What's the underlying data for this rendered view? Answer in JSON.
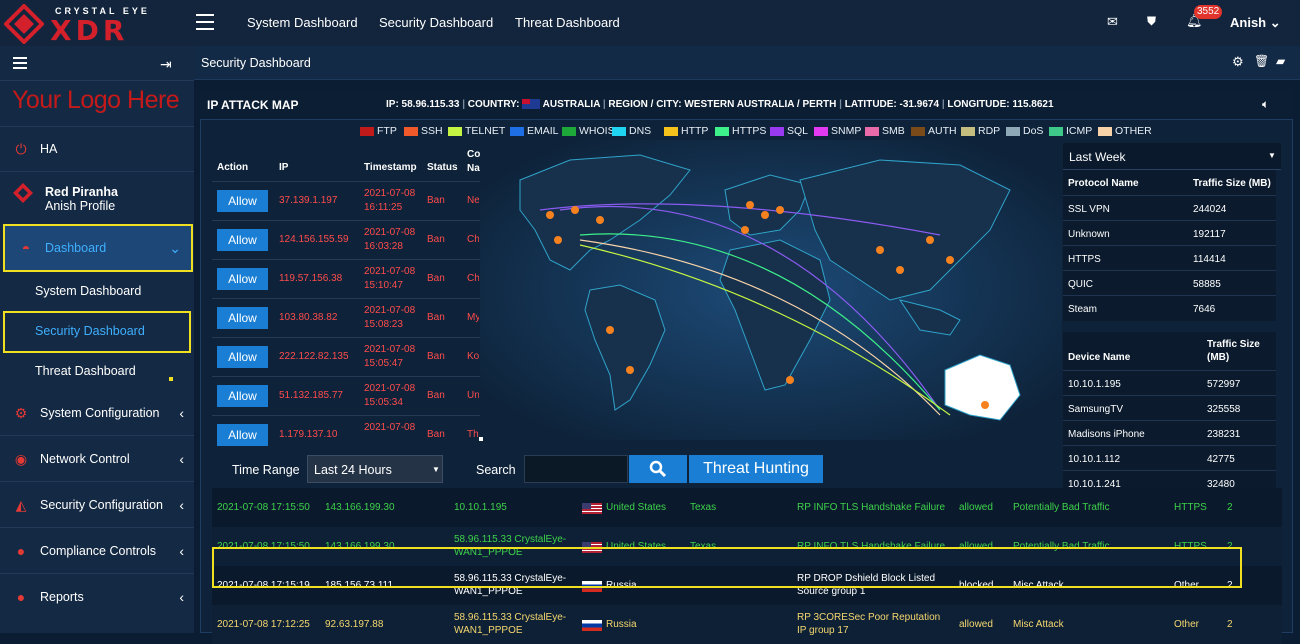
{
  "brand": {
    "title": "CRYSTAL EYE",
    "subtitle": "XDR",
    "logo_here": "Your Logo Here"
  },
  "topnav": {
    "items": [
      "System Dashboard",
      "Security Dashboard",
      "Threat Dashboard"
    ],
    "notif_count": "3552",
    "user": "Anish"
  },
  "sidebar": {
    "ha": "HA",
    "profile_name": "Red Piranha",
    "profile_sub": "Anish Profile",
    "dashboard": "Dashboard",
    "sub_items": [
      "System Dashboard",
      "Security Dashboard",
      "Threat Dashboard"
    ],
    "items": [
      "System Configuration",
      "Network Control",
      "Security Configuration",
      "Compliance Controls",
      "Reports"
    ]
  },
  "content": {
    "title": "Security Dashboard"
  },
  "map_panel": {
    "title": "IP ATTACK MAP",
    "ip": "IP: 58.96.115.33",
    "country_label": "COUNTRY:",
    "country": "AUSTRALIA",
    "region": "REGION / CITY: WESTERN AUSTRALIA / PERTH",
    "latitude": "LATITUDE: -31.9674",
    "longitude": "LONGITUDE: 115.8621"
  },
  "legend": [
    {
      "name": "FTP",
      "color": "#c01a1a"
    },
    {
      "name": "SSH",
      "color": "#f05a2a"
    },
    {
      "name": "TELNET",
      "color": "#c5f542"
    },
    {
      "name": "EMAIL",
      "color": "#1e6fe6"
    },
    {
      "name": "WHOIS",
      "color": "#1fa83a"
    },
    {
      "name": "DNS",
      "color": "#1ed4f0"
    },
    {
      "name": "HTTP",
      "color": "#f5c21c"
    },
    {
      "name": "HTTPS",
      "color": "#3df08a"
    },
    {
      "name": "SQL",
      "color": "#9a3af0"
    },
    {
      "name": "SNMP",
      "color": "#e23af0"
    },
    {
      "name": "SMB",
      "color": "#e86aa8"
    },
    {
      "name": "AUTH",
      "color": "#7a4a18"
    },
    {
      "name": "RDP",
      "color": "#c4bd80"
    },
    {
      "name": "DoS",
      "color": "#8fa8b8"
    },
    {
      "name": "ICMP",
      "color": "#3ec98a"
    },
    {
      "name": "OTHER",
      "color": "#f7d2a8"
    }
  ],
  "attack_table": {
    "headers": [
      "Action",
      "IP",
      "Timestamp",
      "Status",
      "Co\nNa"
    ],
    "action_label": "Allow",
    "rows": [
      {
        "ip": "37.139.1.197",
        "ts1": "2021-07-08",
        "ts2": "16:11:25",
        "status": "Ban",
        "co": "Ne"
      },
      {
        "ip": "124.156.155.59",
        "ts1": "2021-07-08",
        "ts2": "16:03:28",
        "status": "Ban",
        "co": "Ch"
      },
      {
        "ip": "119.57.156.38",
        "ts1": "2021-07-08",
        "ts2": "15:10:47",
        "status": "Ban",
        "co": "Ch"
      },
      {
        "ip": "103.80.38.82",
        "ts1": "2021-07-08",
        "ts2": "15:08:23",
        "status": "Ban",
        "co": "My"
      },
      {
        "ip": "222.122.82.135",
        "ts1": "2021-07-08",
        "ts2": "15:05:47",
        "status": "Ban",
        "co": "Ko Re"
      },
      {
        "ip": "51.132.185.77",
        "ts1": "2021-07-08",
        "ts2": "15:05:34",
        "status": "Ban",
        "co": "Un Kin"
      },
      {
        "ip": "1.179.137.10",
        "ts1": "2021-07-08",
        "ts2": "",
        "status": "Ban",
        "co": "Th"
      }
    ]
  },
  "protocol_table": {
    "range": "Last Week",
    "headers": [
      "Protocol Name",
      "Traffic Size (MB)"
    ],
    "rows": [
      [
        "SSL VPN",
        "244024"
      ],
      [
        "Unknown",
        "192117"
      ],
      [
        "HTTPS",
        "114414"
      ],
      [
        "QUIC",
        "58885"
      ],
      [
        "Steam",
        "7646"
      ]
    ]
  },
  "device_table": {
    "headers": [
      "Device Name",
      "Traffic Size (MB)"
    ],
    "rows": [
      [
        "10.10.1.195",
        "572997"
      ],
      [
        "SamsungTV",
        "325558"
      ],
      [
        "Madisons iPhone",
        "238231"
      ],
      [
        "10.10.1.112",
        "42775"
      ],
      [
        "10.10.1.241",
        "32480"
      ]
    ]
  },
  "search_bar": {
    "time_label": "Time Range",
    "time_value": "Last 24 Hours",
    "search_label": "Search",
    "hunt_label": "Threat Hunting"
  },
  "events": [
    {
      "ts": "2021-07-08 17:15:50",
      "src": "143.166.199.30",
      "dst": "10.10.1.195",
      "country": "United States",
      "region": "Texas",
      "rule": "RP INFO TLS Handshake Failure",
      "action": "allowed",
      "cls": "Potentially Bad Traffic",
      "proto": "HTTPS",
      "sev": "2",
      "flag": "us",
      "color": "#3dd24a"
    },
    {
      "ts": "2021-07-08 17:15:50",
      "src": "143.166.199.30",
      "dst": "58.96.115.33 CrystalEye-WAN1_PPPOE",
      "country": "United States",
      "region": "Texas",
      "rule": "RP INFO TLS Handshake Failure",
      "action": "allowed",
      "cls": "Potentially Bad Traffic",
      "proto": "HTTPS",
      "sev": "2",
      "flag": "us",
      "color": "#3dd24a"
    },
    {
      "ts": "2021-07-08 17:15:19",
      "src": "185.156.73.111",
      "dst": "58.96.115.33 CrystalEye-WAN1_PPPOE",
      "country": "Russia",
      "region": "",
      "rule": "RP DROP Dshield Block Listed Source group 1",
      "action": "blocked",
      "cls": "Misc Attack",
      "proto": "Other",
      "sev": "2",
      "flag": "ru",
      "color": "#ffffff"
    },
    {
      "ts": "2021-07-08 17:12:25",
      "src": "92.63.197.88",
      "dst": "58.96.115.33 CrystalEye-WAN1_PPPOE",
      "country": "Russia",
      "region": "",
      "rule": "RP 3CORESec Poor Reputation IP group 17",
      "action": "allowed",
      "cls": "Misc Attack",
      "proto": "Other",
      "sev": "2",
      "flag": "ru",
      "color": "#f5d76e"
    }
  ]
}
